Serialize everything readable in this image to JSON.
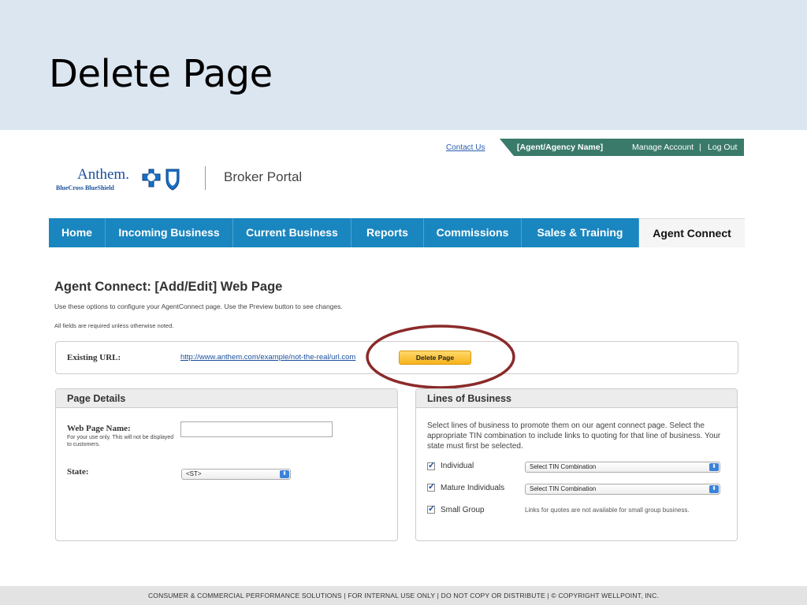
{
  "slide": {
    "title": "Delete Page"
  },
  "utility": {
    "contact_us": "Contact Us",
    "agent_name": "[Agent/Agency Name]",
    "manage_account": "Manage Account",
    "separator": "|",
    "logout": "Log Out"
  },
  "logo": {
    "wordmark": "Anthem.",
    "sub": "BlueCross BlueShield",
    "portal": "Broker Portal"
  },
  "nav": {
    "items": [
      {
        "label": "Home"
      },
      {
        "label": "Incoming Business"
      },
      {
        "label": "Current Business"
      },
      {
        "label": "Reports"
      },
      {
        "label": "Commissions"
      },
      {
        "label": "Sales & Training"
      },
      {
        "label": "Agent Connect"
      }
    ],
    "active": "Agent Connect"
  },
  "page": {
    "heading": "Agent Connect: [Add/Edit] Web Page",
    "description": "Use these options to configure your AgentConnect page.  Use the Preview button to see changes.",
    "note": "All fields are required unless otherwise noted."
  },
  "existing_url": {
    "label": "Existing URL:",
    "value": "http://www.anthem.com/example/not-the-real/url.com",
    "delete_label": "Delete Page"
  },
  "details": {
    "title": "Page Details",
    "name_label": "Web Page Name:",
    "name_help": "For your use only.  This will not be displayed to customers.",
    "name_value": "",
    "state_label": "State:",
    "state_value": "<ST>"
  },
  "lob": {
    "title": "Lines of Business",
    "description": "Select lines of business to promote them on our agent connect page. Select the appropriate TIN combination to include links to quoting for that line of business.  Your state must first be selected.",
    "items": [
      {
        "label": "Individual",
        "checked": true,
        "select": "Select TIN Combination"
      },
      {
        "label": "Mature Individuals",
        "checked": true,
        "select": "Select TIN Combination"
      },
      {
        "label": "Small Group",
        "checked": true,
        "note": "Links for quotes are not available for small group business."
      }
    ]
  },
  "footer": "CONSUMER & COMMERCIAL PERFORMANCE SOLUTIONS   |   FOR INTERNAL USE ONLY   |  DO NOT COPY OR DISTRIBUTE   | © COPYRIGHT  WELLPOINT, INC.",
  "colors": {
    "nav": "#1a86bf",
    "header_band": "#dce6f1",
    "util_bar": "#3a7a6a",
    "callout": "#8b2a2a",
    "delete_button": "#f7b21b"
  }
}
